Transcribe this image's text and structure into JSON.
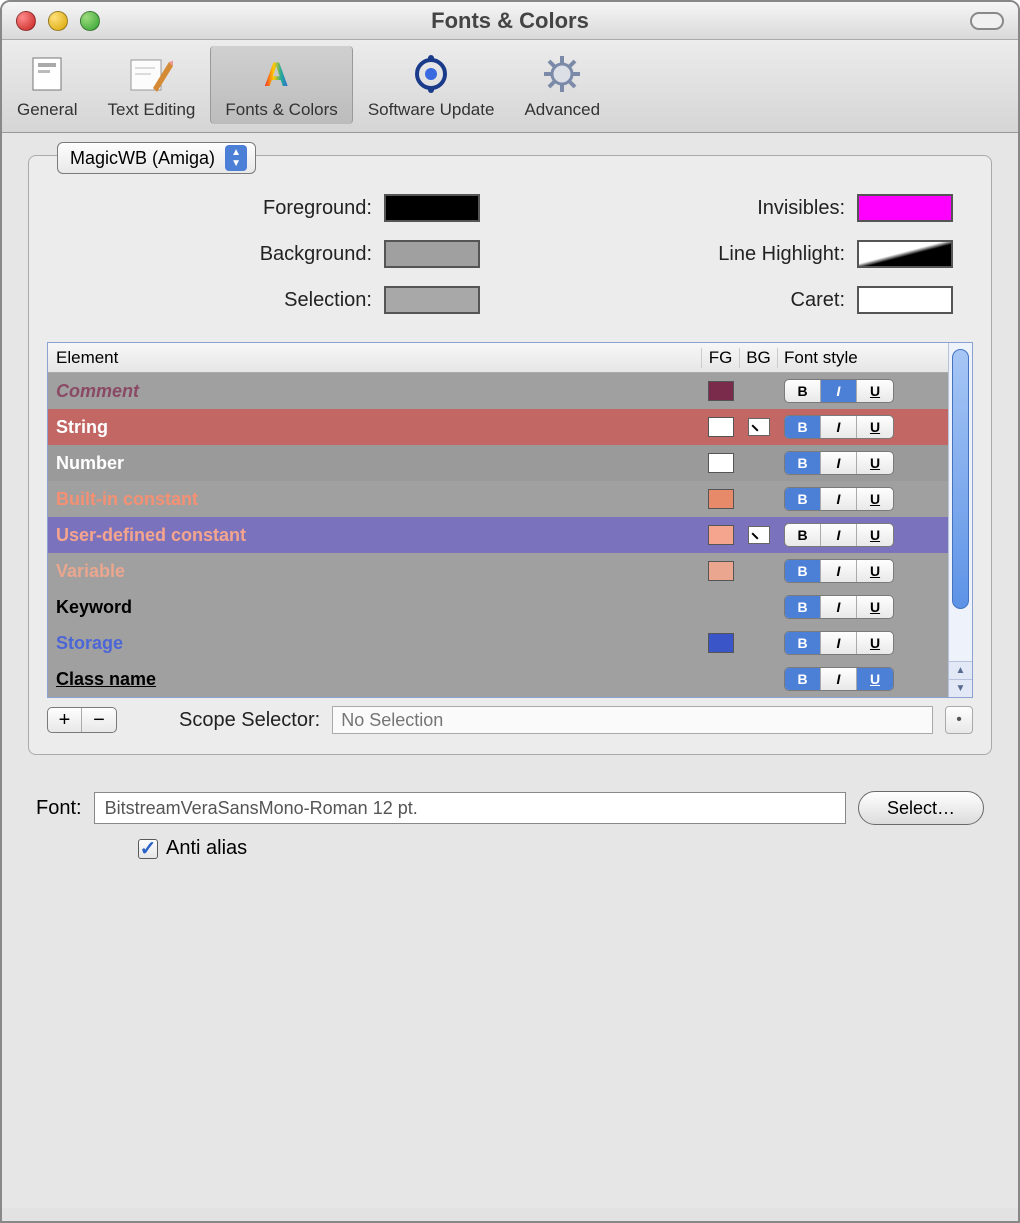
{
  "window": {
    "title": "Fonts & Colors"
  },
  "toolbar": {
    "tabs": [
      {
        "label": "General"
      },
      {
        "label": "Text Editing"
      },
      {
        "label": "Fonts & Colors"
      },
      {
        "label": "Software Update"
      },
      {
        "label": "Advanced"
      }
    ],
    "active_index": 2
  },
  "theme": {
    "selected": "MagicWB (Amiga)"
  },
  "color_wells": {
    "foreground": {
      "label": "Foreground:",
      "color": "#000000"
    },
    "background": {
      "label": "Background:",
      "color": "#a0a0a0"
    },
    "selection": {
      "label": "Selection:",
      "color": "#a8a8a8"
    },
    "invisibles": {
      "label": "Invisibles:",
      "color": "#ff00ff"
    },
    "line_highlight": {
      "label": "Line Highlight:",
      "color": "gradient"
    },
    "caret": {
      "label": "Caret:",
      "color": "#ffffff"
    }
  },
  "table": {
    "headers": {
      "element": "Element",
      "fg": "FG",
      "bg": "BG",
      "font_style": "Font style"
    },
    "rows": [
      {
        "name": "Comment",
        "text_color": "#8a4a63",
        "row_bg": "#a0a0a0",
        "fg": "#7a2a4a",
        "bg": null,
        "bold": false,
        "italic": true,
        "underline": false
      },
      {
        "name": "String",
        "text_color": "#ffffff",
        "row_bg": "#c26763",
        "fg": "#ffffff",
        "bg": "bg",
        "bold": true,
        "italic": false,
        "underline": false
      },
      {
        "name": "Number",
        "text_color": "#ffffff",
        "row_bg": "#9a9a9a",
        "fg": "#ffffff",
        "bg": null,
        "bold": true,
        "italic": false,
        "underline": false
      },
      {
        "name": "Built-in constant",
        "text_color": "#f59073",
        "row_bg": "#a0a0a0",
        "fg": "#e78a6a",
        "bg": null,
        "bold": true,
        "italic": false,
        "underline": false
      },
      {
        "name": "User-defined constant",
        "text_color": "#f5a48d",
        "row_bg": "#7b72bd",
        "fg": "#f5a48d",
        "bg": "bg",
        "bold": false,
        "italic": false,
        "underline": false
      },
      {
        "name": "Variable",
        "text_color": "#eaa68e",
        "row_bg": "#a0a0a0",
        "fg": "#eaa68e",
        "bg": null,
        "bold": true,
        "italic": false,
        "underline": false
      },
      {
        "name": "Keyword",
        "text_color": "#000000",
        "row_bg": "#a0a0a0",
        "fg": null,
        "bg": null,
        "bold": true,
        "italic": false,
        "underline": false
      },
      {
        "name": "Storage",
        "text_color": "#4c66d6",
        "row_bg": "#a0a0a0",
        "fg": "#3a55c8",
        "bg": null,
        "bold": true,
        "italic": false,
        "underline": false
      },
      {
        "name": "Class name",
        "text_color": "#000000",
        "row_bg": "#a0a0a0",
        "fg": null,
        "bg": null,
        "bold": true,
        "italic": false,
        "underline": true
      }
    ]
  },
  "scope": {
    "label": "Scope Selector:",
    "value": "No Selection"
  },
  "buttons": {
    "plus": "+",
    "minus": "−",
    "select": "Select…"
  },
  "font": {
    "label": "Font:",
    "value": "BitstreamVeraSansMono-Roman 12 pt."
  },
  "antialias": {
    "label": "Anti alias",
    "checked": true
  },
  "style_letters": {
    "B": "B",
    "I": "I",
    "U": "U"
  }
}
